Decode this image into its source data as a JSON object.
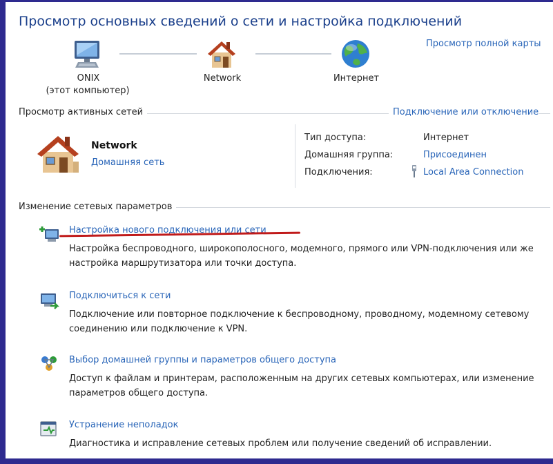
{
  "title": "Просмотр основных сведений о сети и настройка подключений",
  "full_map_link": "Просмотр полной карты",
  "network_map": {
    "computer": {
      "name": "ONIX",
      "sub": "(этот компьютер)",
      "icon": "computer-icon"
    },
    "network": {
      "name": "Network",
      "icon": "house-icon"
    },
    "internet": {
      "name": "Интернет",
      "icon": "globe-icon"
    }
  },
  "active_networks": {
    "heading": "Просмотр активных сетей",
    "connect_link": "Подключение или отключение",
    "network_name": "Network",
    "network_type": "Домашняя сеть",
    "access_type_label": "Тип доступа:",
    "access_type_value": "Интернет",
    "homegroup_label": "Домашняя группа:",
    "homegroup_value": "Присоединен",
    "connections_label": "Подключения:",
    "connections_value": "Local Area Connection"
  },
  "change_settings": {
    "heading": "Изменение сетевых параметров",
    "tasks": [
      {
        "title": "Настройка нового подключения или сети",
        "desc": "Настройка беспроводного, широкополосного, модемного, прямого или VPN-подключения или же настройка маршрутизатора или точки доступа.",
        "icon": "new-connection-icon"
      },
      {
        "title": "Подключиться к сети",
        "desc": "Подключение или повторное подключение к беспроводному, проводному, модемному сетевому соединению или подключение к VPN.",
        "icon": "connect-network-icon"
      },
      {
        "title": "Выбор домашней группы и параметров общего доступа",
        "desc": "Доступ к файлам и принтерам, расположенным на других сетевых компьютерах, или изменение параметров общего доступа.",
        "icon": "homegroup-icon"
      },
      {
        "title": "Устранение неполадок",
        "desc": "Диагностика и исправление сетевых проблем или получение сведений об исправлении.",
        "icon": "troubleshoot-icon"
      }
    ]
  },
  "colors": {
    "frame": "#2e2a8f",
    "title": "#1a3f8b",
    "link": "#2965b8",
    "highlight_underline": "#c01a1a"
  }
}
